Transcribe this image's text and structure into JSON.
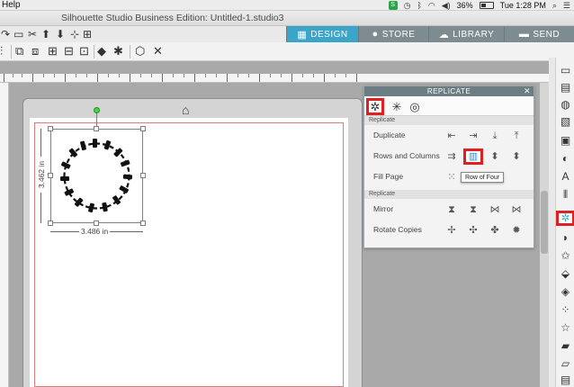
{
  "menubar": {
    "app_menu": "Help",
    "battery": "36%",
    "clock": "Tue 1:28 PM"
  },
  "window": {
    "title": "Silhouette Studio Business Edition: Untitled-1.studio3"
  },
  "nav_tabs": [
    {
      "label": "DESIGN",
      "icon": "grid-icon",
      "active": true
    },
    {
      "label": "STORE",
      "icon": "store-icon",
      "active": false
    },
    {
      "label": "LIBRARY",
      "icon": "cloud-icon",
      "active": false
    },
    {
      "label": "SEND",
      "icon": "send-icon",
      "active": false
    }
  ],
  "canvas": {
    "width_label": "3.486 in",
    "height_label": "3.462 in"
  },
  "replicate_panel": {
    "title": "REPLICATE",
    "section1": "Replicate",
    "rows": [
      {
        "label": "Duplicate"
      },
      {
        "label": "Rows and Columns"
      },
      {
        "label": "Fill Page"
      }
    ],
    "section2": "Replicate",
    "rows2": [
      {
        "label": "Mirror"
      },
      {
        "label": "Rotate Copies"
      }
    ],
    "tooltip": "Row of Four"
  },
  "colors": {
    "accent": "#3ba5c9",
    "nav_inactive": "#7d8c91",
    "highlight": "#e02020",
    "workspace": "#a9a9a9"
  }
}
